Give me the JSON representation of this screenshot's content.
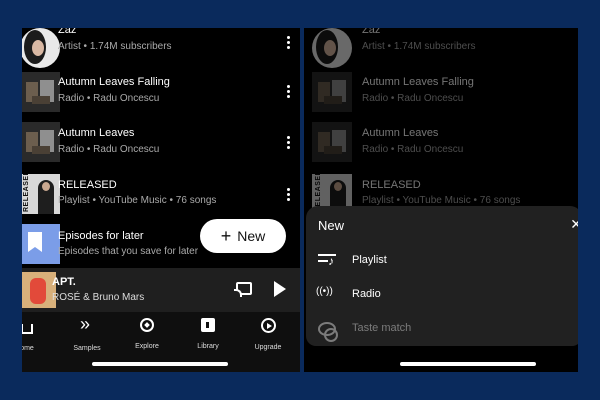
{
  "list": [
    {
      "title": "Zaz",
      "subtitle": "Artist • 1.74M subscribers",
      "thumb": "artist-photo"
    },
    {
      "title": "Autumn Leaves Falling",
      "subtitle": "Radio • Radu Oncescu",
      "thumb": "radio-art"
    },
    {
      "title": "Autumn Leaves",
      "subtitle": "Radio • Radu Oncescu",
      "thumb": "radio-art"
    },
    {
      "title": "RELEASED",
      "subtitle": "Playlist • YouTube Music • 76 songs",
      "thumb": "released-art",
      "thumb_text": "RELEASED"
    },
    {
      "title": "Episodes for later",
      "subtitle": "Episodes that you save for later",
      "thumb": "bookmark-icon"
    }
  ],
  "fab": {
    "label": "New",
    "icon": "plus-icon"
  },
  "mini_player": {
    "title": "APT.",
    "artist": "ROSÉ & Bruno Mars"
  },
  "bottom_nav": [
    {
      "label": "ome",
      "icon": "home-icon"
    },
    {
      "label": "Samples",
      "icon": "samples-icon"
    },
    {
      "label": "Explore",
      "icon": "compass-icon"
    },
    {
      "label": "Library",
      "icon": "library-icon"
    },
    {
      "label": "Upgrade",
      "icon": "upgrade-icon"
    }
  ],
  "sheet": {
    "title": "New",
    "items": [
      {
        "label": "Playlist",
        "icon": "playlist-add-icon",
        "enabled": true
      },
      {
        "label": "Radio",
        "icon": "radio-icon",
        "enabled": true
      },
      {
        "label": "Taste match",
        "icon": "taste-match-icon",
        "enabled": false
      }
    ]
  },
  "colors": {
    "page_bg": "#0a2a5c",
    "screen_bg": "#000000",
    "sheet_bg": "#212121",
    "fab_bg": "#ffffff"
  }
}
